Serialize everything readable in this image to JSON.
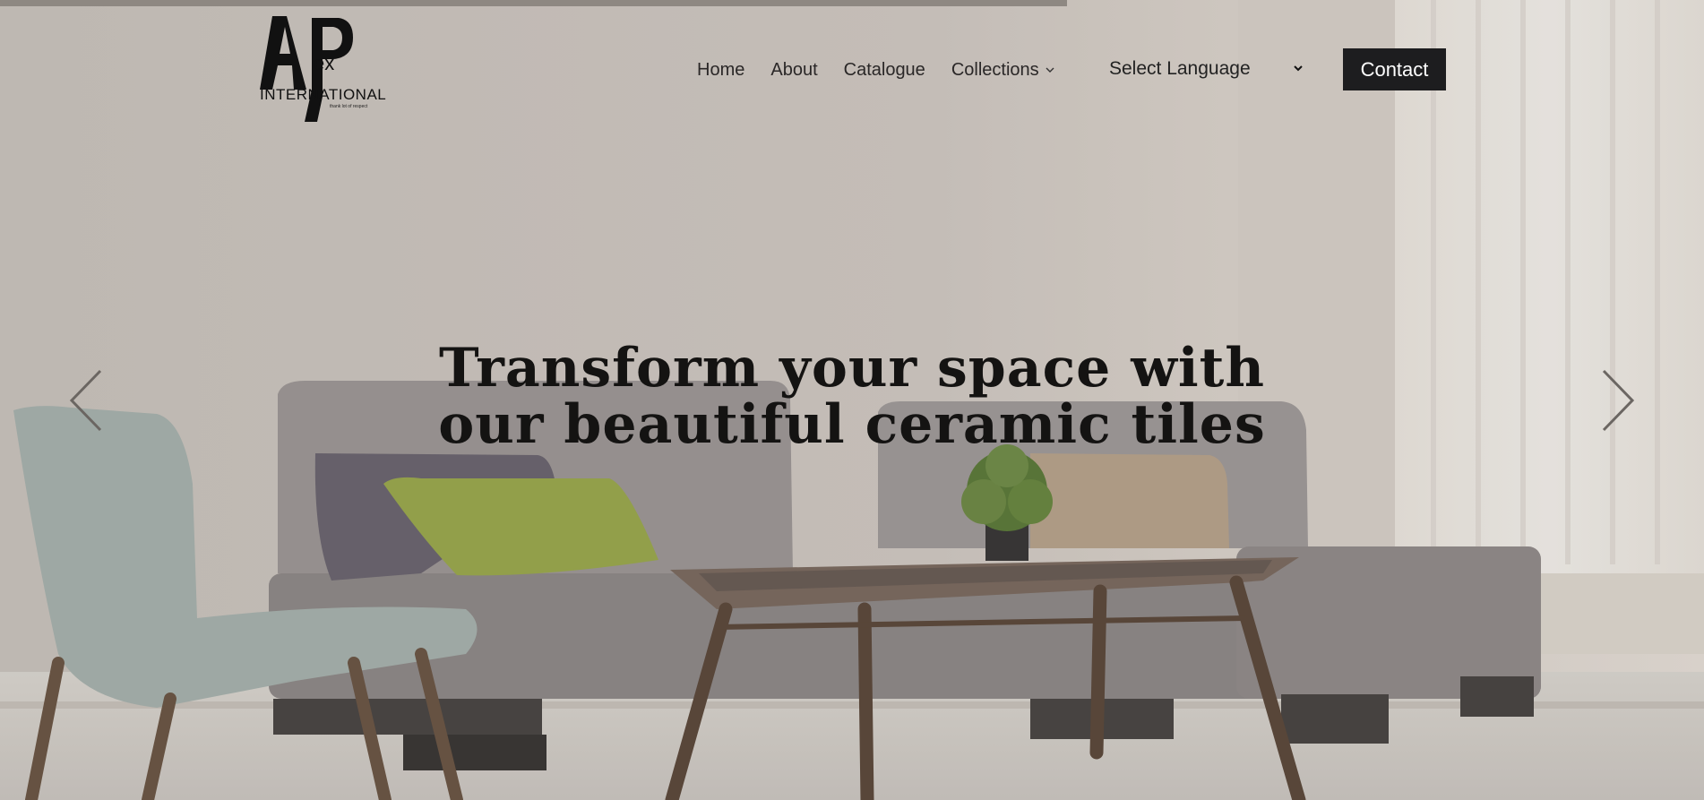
{
  "logo": {
    "mark_letters": "AP",
    "mark_suffix": "ex",
    "name": "INTERNATIONAL",
    "tagline": "thank lot of respect"
  },
  "nav": {
    "items": [
      {
        "label": "Home"
      },
      {
        "label": "About"
      },
      {
        "label": "Catalogue"
      },
      {
        "label": "Collections"
      }
    ]
  },
  "language": {
    "selected": "Select Language"
  },
  "contact": {
    "label": "Contact"
  },
  "hero": {
    "line1": "Transform your space with",
    "line2": "our beautiful ceramic tiles",
    "slide_progress": 0.626
  },
  "icons": {
    "prev": "chevron-left-icon",
    "next": "chevron-right-icon",
    "collections": "chevron-down-icon",
    "language": "chevron-down-icon"
  }
}
